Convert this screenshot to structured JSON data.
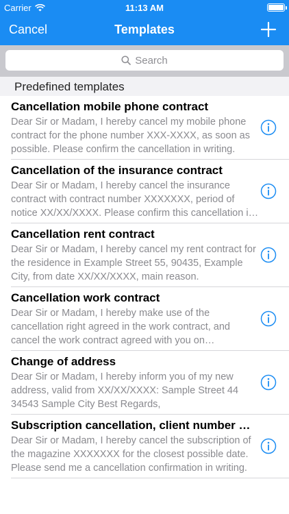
{
  "status": {
    "carrier": "Carrier",
    "time": "11:13 AM"
  },
  "nav": {
    "cancel": "Cancel",
    "title": "Templates"
  },
  "search": {
    "placeholder": "Search"
  },
  "section": {
    "title": "Predefined templates"
  },
  "templates": [
    {
      "title": "Cancellation mobile phone contract",
      "body": "Dear Sir or Madam,  I hereby cancel my mobile phone contract for the phone number XXX-XXXX, as soon as possible.  Please confirm the cancellation in writing."
    },
    {
      "title": "Cancellation of the insurance contract",
      "body": "Dear Sir or Madam,  I hereby cancel the insurance contract with contract number XXXXXXX, period of notice XX/XX/XXXX.  Please confirm this cancellation in writing."
    },
    {
      "title": "Cancellation rent contract",
      "body": "Dear Sir or Madam,  I hereby cancel my rent contract for the residence in Example Street 55, 90435, Example City, from date XX/XX/XXXX, main reason."
    },
    {
      "title": "Cancellation work contract",
      "body": "Dear Sir or Madam,  I hereby make use of the cancellation right agreed in the work contract, and cancel the work contract agreed with you on XX/XX/XXXX."
    },
    {
      "title": "Change of address",
      "body": "Dear Sir or Madam,  I hereby inform you of my new address, valid from XX/XX/XXXX:  Sample Street 44 34543 Sample City  Best Regards,"
    },
    {
      "title": "Subscription cancellation, client number XXXXXXX",
      "body": "Dear Sir or Madam,  I hereby cancel the subscription of the magazine XXXXXXX for the closest possible date.  Please send me a cancellation confirmation in writing."
    }
  ],
  "colors": {
    "accent": "#1a8cf3",
    "info": "#1a8cf3"
  }
}
